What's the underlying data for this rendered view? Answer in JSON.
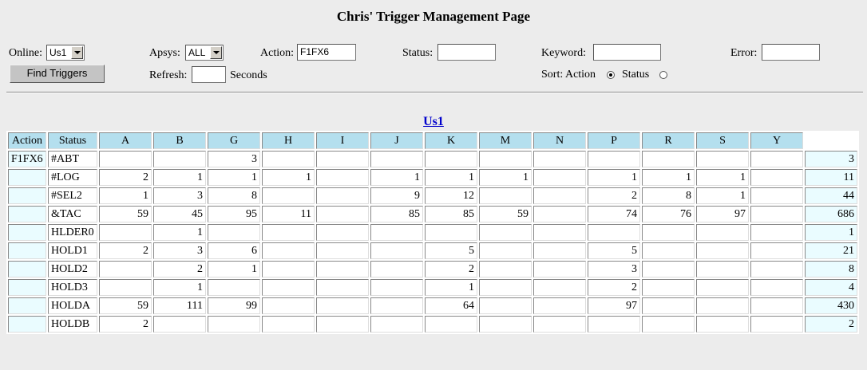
{
  "page": {
    "title": "Chris' Trigger Management Page"
  },
  "form": {
    "online_label": "Online:",
    "online_value": "Us1",
    "apsys_label": "Apsys:",
    "apsys_value": "ALL",
    "action_label": "Action:",
    "action_value": "F1FX6",
    "status_label": "Status:",
    "status_value": "",
    "keyword_label": "Keyword:",
    "keyword_value": "",
    "error_label": "Error:",
    "error_value": "",
    "find_button": "Find Triggers",
    "refresh_label": "Refresh:",
    "refresh_value": "",
    "seconds_label": "Seconds",
    "sort_label": "Sort: Action",
    "sort_status_label": "Status",
    "sort_selected": "Action"
  },
  "results": {
    "link_label": "Us1",
    "headers": [
      "Action",
      "Status",
      "A",
      "B",
      "G",
      "H",
      "I",
      "J",
      "K",
      "M",
      "N",
      "P",
      "R",
      "S",
      "Y",
      ""
    ],
    "rows": [
      [
        "F1FX6",
        "#ABT",
        "",
        "",
        "3",
        "",
        "",
        "",
        "",
        "",
        "",
        "",
        "",
        "",
        "",
        "3"
      ],
      [
        "",
        "#LOG",
        "2",
        "1",
        "1",
        "1",
        "",
        "1",
        "1",
        "1",
        "",
        "1",
        "1",
        "1",
        "",
        "11"
      ],
      [
        "",
        "#SEL2",
        "1",
        "3",
        "8",
        "",
        "",
        "9",
        "12",
        "",
        "",
        "2",
        "8",
        "1",
        "",
        "44"
      ],
      [
        "",
        "&TAC",
        "59",
        "45",
        "95",
        "11",
        "",
        "85",
        "85",
        "59",
        "",
        "74",
        "76",
        "97",
        "",
        "686"
      ],
      [
        "",
        "HLDER0",
        "",
        "1",
        "",
        "",
        "",
        "",
        "",
        "",
        "",
        "",
        "",
        "",
        "",
        "1"
      ],
      [
        "",
        "HOLD1",
        "2",
        "3",
        "6",
        "",
        "",
        "",
        "5",
        "",
        "",
        "5",
        "",
        "",
        "",
        "21"
      ],
      [
        "",
        "HOLD2",
        "",
        "2",
        "1",
        "",
        "",
        "",
        "2",
        "",
        "",
        "3",
        "",
        "",
        "",
        "8"
      ],
      [
        "",
        "HOLD3",
        "",
        "1",
        "",
        "",
        "",
        "",
        "1",
        "",
        "",
        "2",
        "",
        "",
        "",
        "4"
      ],
      [
        "",
        "HOLDA",
        "59",
        "111",
        "99",
        "",
        "",
        "",
        "64",
        "",
        "",
        "97",
        "",
        "",
        "",
        "430"
      ],
      [
        "",
        "HOLDB",
        "2",
        "",
        "",
        "",
        "",
        "",
        "",
        "",
        "",
        "",
        "",
        "",
        "",
        "2"
      ]
    ]
  }
}
